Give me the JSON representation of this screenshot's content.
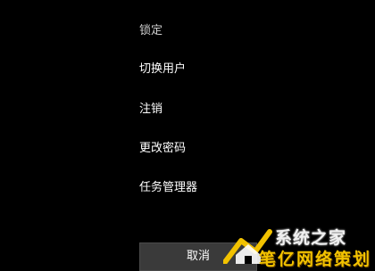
{
  "menu": {
    "items": [
      {
        "label": "锁定"
      },
      {
        "label": "切换用户"
      },
      {
        "label": "注销"
      },
      {
        "label": "更改密码"
      },
      {
        "label": "任务管理器"
      }
    ]
  },
  "cancel_label": "取消",
  "watermark": {
    "line1": "系统之家",
    "line2": "笔亿网络策划"
  },
  "colors": {
    "background": "#000000",
    "text": "#ffffff",
    "button_bg": "#3a3a3a",
    "watermark_accent": "#f2c200"
  }
}
